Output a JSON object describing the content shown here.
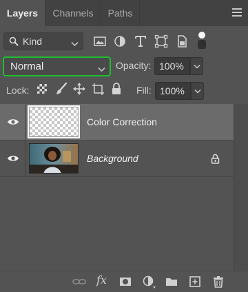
{
  "tabs": [
    {
      "label": "Layers",
      "active": true
    },
    {
      "label": "Channels",
      "active": false
    },
    {
      "label": "Paths",
      "active": false
    }
  ],
  "filter": {
    "kind_label": "Kind",
    "icons": [
      "image-filter-icon",
      "adjustment-filter-icon",
      "type-filter-icon",
      "shape-filter-icon",
      "smart-object-filter-icon",
      "filter-toggle-icon"
    ]
  },
  "blend": {
    "mode": "Normal",
    "highlight_color": "#1ebf2e"
  },
  "opacity": {
    "label": "Opacity:",
    "value": "100%"
  },
  "lock": {
    "label": "Lock:",
    "icons": [
      "lock-transparent-pixels-icon",
      "lock-image-pixels-icon",
      "lock-position-icon",
      "lock-artboard-icon",
      "lock-all-icon"
    ]
  },
  "fill": {
    "label": "Fill:",
    "value": "100%"
  },
  "layers": [
    {
      "name": "Color Correction",
      "selected": true,
      "visible": true,
      "italic": false,
      "thumbnail": "transparent-checkerboard"
    },
    {
      "name": "Background",
      "selected": false,
      "visible": true,
      "italic": true,
      "locked": true,
      "thumbnail": "photo-woman-smiling"
    }
  ],
  "bottom_bar": {
    "fx_label": "fx",
    "icons": [
      "link-layers-icon",
      "layer-style-icon",
      "add-mask-icon",
      "new-adjustment-layer-icon",
      "new-group-icon",
      "new-layer-icon",
      "delete-layer-icon"
    ]
  }
}
